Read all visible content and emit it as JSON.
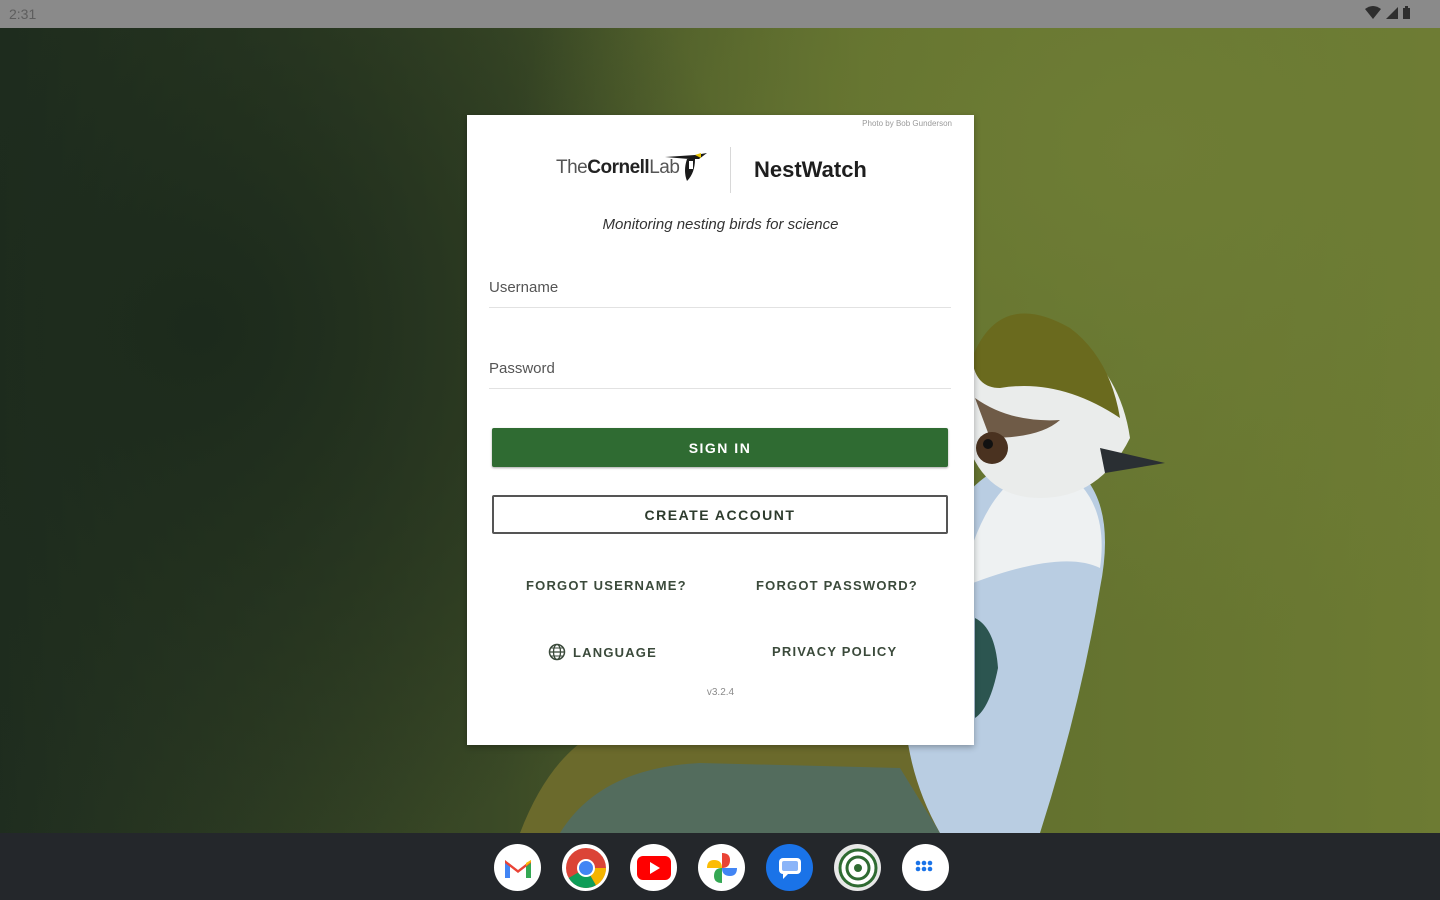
{
  "status_bar": {
    "time": "2:31"
  },
  "card": {
    "photo_credit": "Photo by Bob Gunderson",
    "logo_the": "The",
    "logo_cornell": "Cornell",
    "logo_lab": "Lab",
    "app_name": "NestWatch",
    "tagline": "Monitoring nesting birds for science",
    "username_placeholder": "Username",
    "password_placeholder": "Password",
    "sign_in_label": "SIGN IN",
    "create_account_label": "CREATE ACCOUNT",
    "forgot_username_label": "FORGOT USERNAME?",
    "forgot_password_label": "FORGOT PASSWORD?",
    "language_label": "LANGUAGE",
    "privacy_policy_label": "PRIVACY POLICY",
    "version": "v3.2.4"
  },
  "dock": {
    "apps": [
      {
        "icon": "gmail-icon"
      },
      {
        "icon": "chrome-icon"
      },
      {
        "icon": "youtube-icon"
      },
      {
        "icon": "photos-icon"
      },
      {
        "icon": "messages-icon"
      },
      {
        "icon": "nestwatch-icon"
      },
      {
        "icon": "app-drawer-icon"
      }
    ]
  },
  "colors": {
    "primary": "#2f6b32",
    "dock": "#24272b",
    "statusbar": "#8a8a8a"
  }
}
